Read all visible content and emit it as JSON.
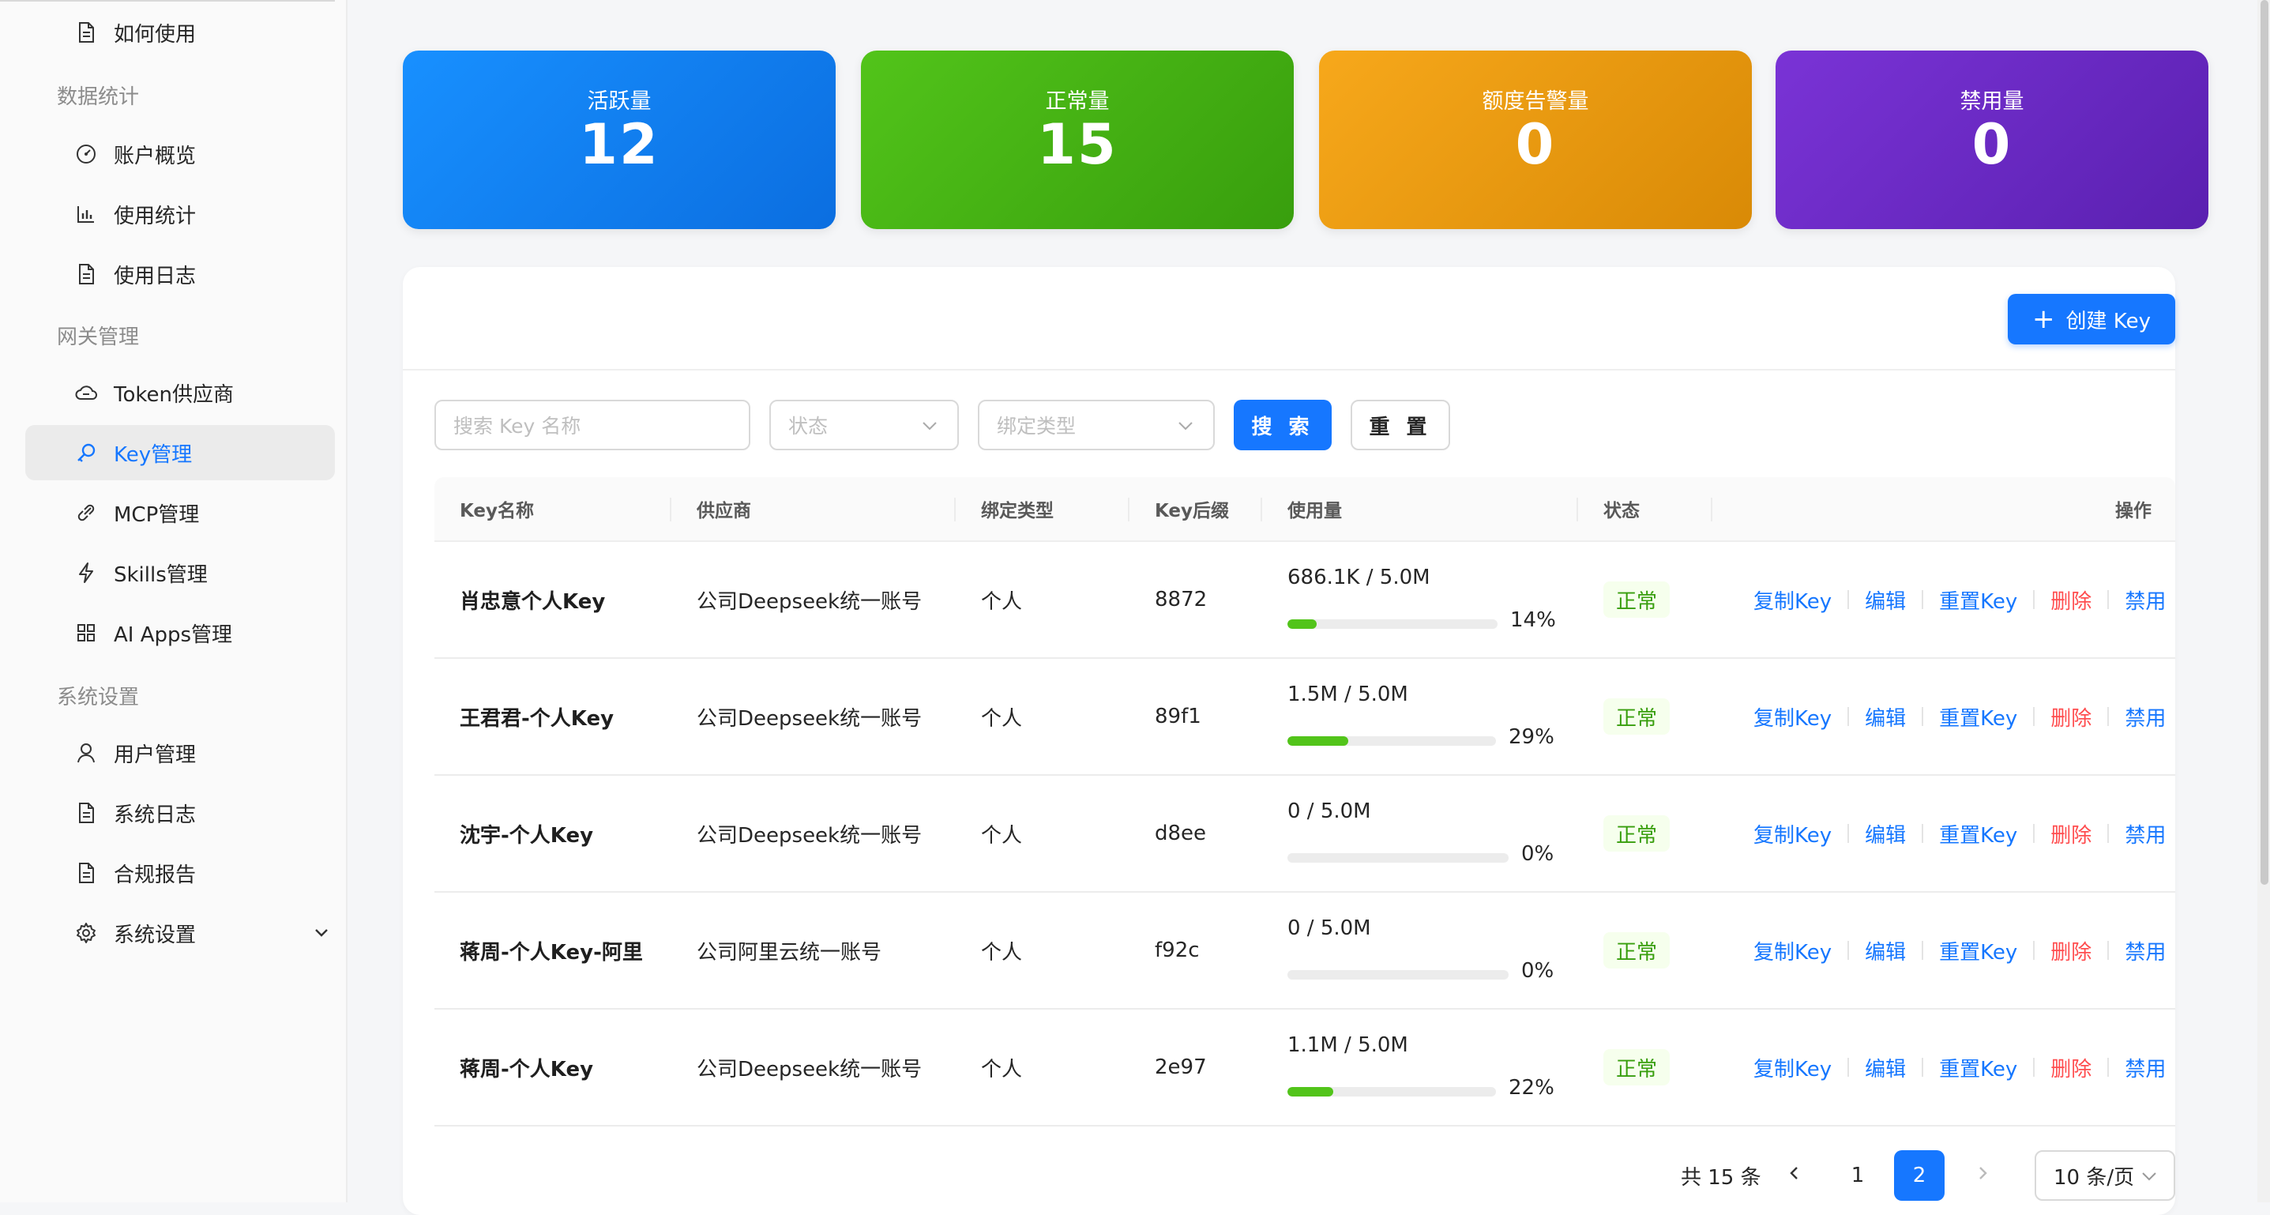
{
  "sidebar": {
    "items": [
      {
        "label": "如何使用",
        "icon": "doc-icon"
      },
      {
        "label": "账户概览",
        "icon": "dashboard-icon"
      },
      {
        "label": "使用统计",
        "icon": "bar-chart-icon"
      },
      {
        "label": "使用日志",
        "icon": "doc-icon"
      },
      {
        "label": "Token供应商",
        "icon": "cloud-icon"
      },
      {
        "label": "Key管理",
        "icon": "key-icon",
        "active": true
      },
      {
        "label": "MCP管理",
        "icon": "link-icon"
      },
      {
        "label": "Skills管理",
        "icon": "bolt-icon"
      },
      {
        "label": "AI Apps管理",
        "icon": "grid-icon"
      },
      {
        "label": "用户管理",
        "icon": "user-icon"
      },
      {
        "label": "系统日志",
        "icon": "doc-icon"
      },
      {
        "label": "合规报告",
        "icon": "doc-icon"
      },
      {
        "label": "系统设置",
        "icon": "gear-icon"
      }
    ],
    "groups": [
      "数据统计",
      "网关管理",
      "系统设置"
    ]
  },
  "stats": [
    {
      "title": "活跃量",
      "value": "12",
      "color": "#1677ff"
    },
    {
      "title": "正常量",
      "value": "15",
      "color": "#52c41a"
    },
    {
      "title": "额度告警量",
      "value": "0",
      "color": "#f5a214"
    },
    {
      "title": "禁用量",
      "value": "0",
      "color": "#722ed1"
    }
  ],
  "toolbar": {
    "create_label": "创建 Key"
  },
  "filters": {
    "search_placeholder": "搜索 Key 名称",
    "status_placeholder": "状态",
    "bind_placeholder": "绑定类型",
    "search_label": "搜 索",
    "reset_label": "重 置"
  },
  "table": {
    "headers": [
      "Key名称",
      "供应商",
      "绑定类型",
      "Key后缀",
      "使用量",
      "状态",
      "操作"
    ],
    "rows": [
      {
        "name": "肖忠意个人Key",
        "provider": "公司Deepseek统一账号",
        "bind": "个人",
        "suffix": "8872",
        "usage": "686.1K / 5.0M",
        "pct": "14%",
        "fill": 0.14,
        "status": "正常"
      },
      {
        "name": "王君君-个人Key",
        "provider": "公司Deepseek统一账号",
        "bind": "个人",
        "suffix": "89f1",
        "usage": "1.5M / 5.0M",
        "pct": "29%",
        "fill": 0.29,
        "status": "正常"
      },
      {
        "name": "沈宇-个人Key",
        "provider": "公司Deepseek统一账号",
        "bind": "个人",
        "suffix": "d8ee",
        "usage": "0 / 5.0M",
        "pct": "0%",
        "fill": 0,
        "status": "正常"
      },
      {
        "name": "蒋周-个人Key-阿里",
        "provider": "公司阿里云统一账号",
        "bind": "个人",
        "suffix": "f92c",
        "usage": "0 / 5.0M",
        "pct": "0%",
        "fill": 0,
        "status": "正常"
      },
      {
        "name": "蒋周-个人Key",
        "provider": "公司Deepseek统一账号",
        "bind": "个人",
        "suffix": "2e97",
        "usage": "1.1M / 5.0M",
        "pct": "22%",
        "fill": 0.22,
        "status": "正常"
      }
    ],
    "actions": [
      "复制Key",
      "编辑",
      "重置Key",
      "删除",
      "禁用"
    ]
  },
  "pagination": {
    "total": "共 15 条",
    "pages": [
      "1",
      "2"
    ],
    "current": "2",
    "page_size": "10 条/页"
  }
}
